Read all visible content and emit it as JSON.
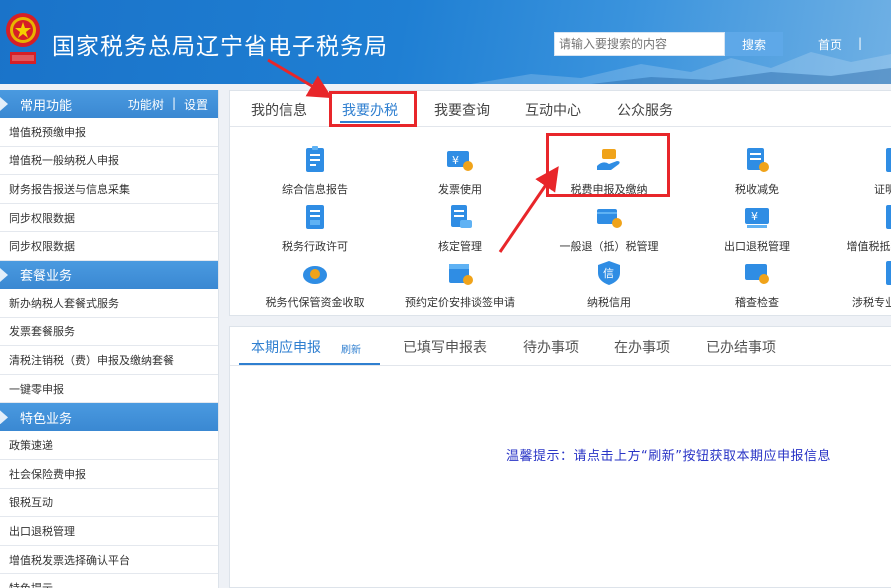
{
  "header": {
    "title": "国家税务总局辽宁省电子税务局",
    "search_placeholder": "请输入要搜索的内容",
    "search_button": "搜索",
    "home_link": "首页",
    "separator": "|"
  },
  "sidebar": {
    "sections": [
      {
        "title": "常用功能",
        "tools": [
          "功能树",
          "|",
          "设置"
        ],
        "items": [
          "增值税预缴申报",
          "增值税一般纳税人申报",
          "财务报告报送与信息采集",
          "同步权限数据",
          "同步权限数据"
        ]
      },
      {
        "title": "套餐业务",
        "items": [
          "新办纳税人套餐式服务",
          "发票套餐服务",
          "清税注销税（费）申报及缴纳套餐",
          "一键零申报"
        ]
      },
      {
        "title": "特色业务",
        "items": [
          "政策速递",
          "社会保险费申报",
          "银税互动",
          "出口退税管理",
          "增值税发票选择确认平台",
          "特色提示"
        ]
      }
    ]
  },
  "main_tabs": [
    "我的信息",
    "我要办税",
    "我要查询",
    "互动中心",
    "公众服务"
  ],
  "functions": [
    [
      "综合信息报告",
      "发票使用",
      "税费申报及缴纳",
      "税收减免",
      "证明开具"
    ],
    [
      "税务行政许可",
      "核定管理",
      "一般退（抵）税管理",
      "出口退税管理",
      "增值税抵扣凭证管理"
    ],
    [
      "税务代保管资金收取",
      "预约定价安排谈签申请",
      "纳税信用",
      "稽查检查",
      "涉税专业服务机构"
    ]
  ],
  "icon_chars": {
    "invoice": "¥",
    "refund": "¥",
    "credit": "信"
  },
  "bottom": {
    "tabs": [
      "本期应申报",
      "已填写申报表",
      "待办事项",
      "在办事项",
      "已办结事项"
    ],
    "refresh": "刷新",
    "hint": "温馨提示：请点击上方“刷新”按钮获取本期应申报信息"
  },
  "colors": {
    "header_blue": "#1f7fd3",
    "accent_blue": "#2f7fd0",
    "highlight_red": "#e8262a",
    "hint_text": "#2a35c6"
  }
}
